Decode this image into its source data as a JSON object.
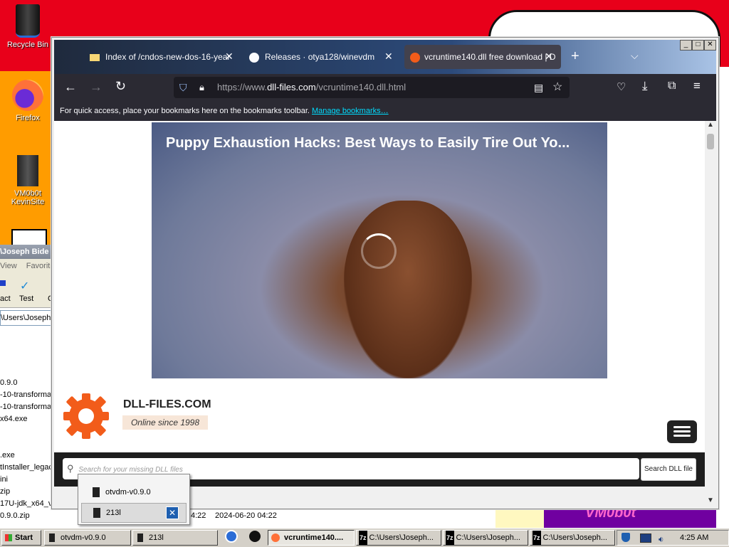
{
  "desktop": {
    "icons": [
      {
        "label": "Recycle Bin"
      },
      {
        "label": "Firefox"
      },
      {
        "label": "VM0b0t KevinSite"
      }
    ],
    "wallpaper_text": "VM0b0t"
  },
  "explorer_bg": {
    "title": "\\Joseph Bide",
    "menu": [
      "View",
      "Favorite"
    ],
    "toolbar": [
      "act",
      "Test",
      "C"
    ],
    "address": "\\Users\\Joseph",
    "files": [
      "0.9.0",
      "-10-transforma",
      "-10-transforma",
      "x64.exe",
      ".exe",
      "tInstaller_legac",
      "ini",
      "zip",
      "17U-jdk_x64_v",
      "0.9.0.zip"
    ],
    "date_short": "4:22",
    "date_full": "2024-06-20 04:22"
  },
  "browser": {
    "tabs": [
      {
        "label": "Index of /cndos-new-dos-16-year",
        "icon": "folder-icon"
      },
      {
        "label": "Releases · otya128/winevdm",
        "icon": "github-icon"
      },
      {
        "label": "vcruntime140.dll free download | D",
        "icon": "dll-files-icon",
        "active": true
      }
    ],
    "url_prefix": "https://www.",
    "url_domain": "dll-files.com",
    "url_path": "/vcruntime140.dll.html",
    "bookmarks_text": "For quick access, place your bookmarks here on the bookmarks toolbar.",
    "bookmarks_link": "Manage bookmarks…"
  },
  "page": {
    "video_title": "Puppy Exhaustion Hacks: Best Ways to Easily Tire Out Yo...",
    "brand_name": "DLL-FILES.COM",
    "brand_tagline": "Online since 1998",
    "search_placeholder": "Search for your missing DLL files",
    "search_button": "Search DLL file"
  },
  "popup": {
    "items": [
      "otvdm-v0.9.0",
      "213l"
    ]
  },
  "taskbar": {
    "start": "Start",
    "buttons": [
      "otvdm-v0.9.0",
      "213l",
      "vcruntime140....",
      "C:\\Users\\Joseph...",
      "C:\\Users\\Joseph...",
      "C:\\Users\\Joseph..."
    ],
    "clock": "4:25 AM"
  },
  "colors": {
    "desktop_red": "#e8001a",
    "firefox_dark": "#2b2a33",
    "brand_orange": "#f25c1a",
    "taskbar_gray": "#d4d0c8"
  }
}
